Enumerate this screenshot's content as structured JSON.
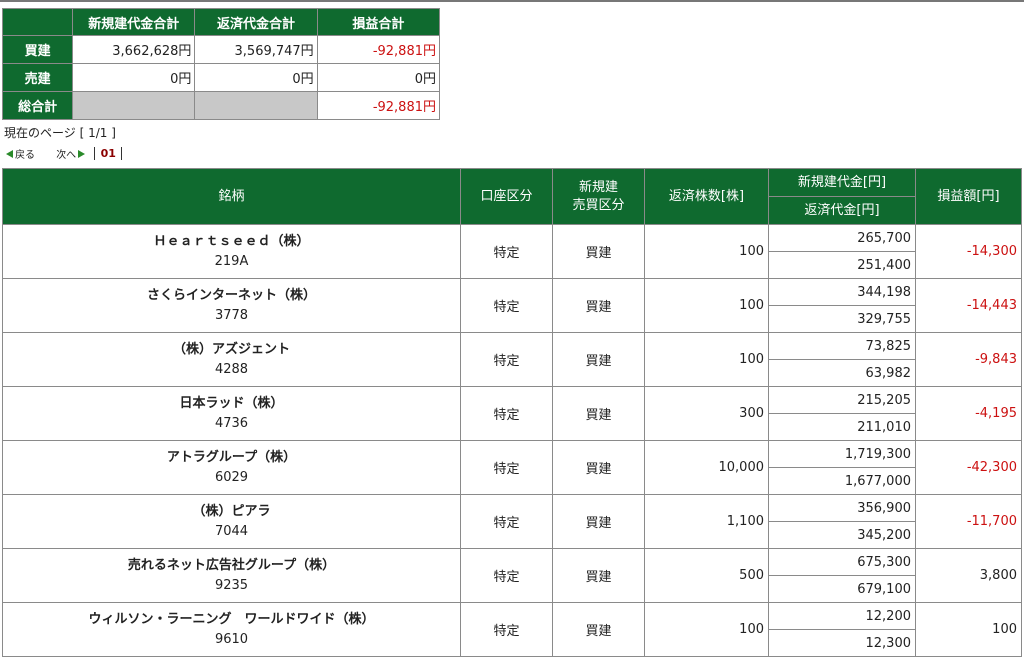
{
  "summary": {
    "headers": [
      "",
      "新規建代金合計",
      "返済代金合計",
      "損益合計"
    ],
    "rows": [
      {
        "label": "買建",
        "new_total": "3,662,628円",
        "return_total": "3,569,747円",
        "pl_total": "-92,881円"
      },
      {
        "label": "売建",
        "new_total": "0円",
        "return_total": "0円",
        "pl_total": "0円"
      },
      {
        "label": "総合計",
        "new_total": "",
        "return_total": "",
        "pl_total": "-92,881円"
      }
    ]
  },
  "pager": {
    "page_info": "現在のページ [ 1/1 ]",
    "back_label": "戻る",
    "next_label": "次へ",
    "current_page": "01"
  },
  "positions": {
    "headers": {
      "name": "銘柄",
      "account": "口座区分",
      "trade_type": "新規建\n売買区分",
      "shares": "返済株数[株]",
      "new_amount": "新規建代金[円]",
      "return_amount": "返済代金[円]",
      "pl": "損益額[円]"
    },
    "rows": [
      {
        "name": "Ｈｅａｒｔｓｅｅｄ（株）",
        "code": "219A",
        "account": "特定",
        "trade_type": "買建",
        "shares": "100",
        "new_amount": "265,700",
        "return_amount": "251,400",
        "pl": "-14,300"
      },
      {
        "name": "さくらインターネット（株）",
        "code": "3778",
        "account": "特定",
        "trade_type": "買建",
        "shares": "100",
        "new_amount": "344,198",
        "return_amount": "329,755",
        "pl": "-14,443"
      },
      {
        "name": "（株）アズジェント",
        "code": "4288",
        "account": "特定",
        "trade_type": "買建",
        "shares": "100",
        "new_amount": "73,825",
        "return_amount": "63,982",
        "pl": "-9,843"
      },
      {
        "name": "日本ラッド（株）",
        "code": "4736",
        "account": "特定",
        "trade_type": "買建",
        "shares": "300",
        "new_amount": "215,205",
        "return_amount": "211,010",
        "pl": "-4,195"
      },
      {
        "name": "アトラグループ（株）",
        "code": "6029",
        "account": "特定",
        "trade_type": "買建",
        "shares": "10,000",
        "new_amount": "1,719,300",
        "return_amount": "1,677,000",
        "pl": "-42,300"
      },
      {
        "name": "（株）ピアラ",
        "code": "7044",
        "account": "特定",
        "trade_type": "買建",
        "shares": "1,100",
        "new_amount": "356,900",
        "return_amount": "345,200",
        "pl": "-11,700"
      },
      {
        "name": "売れるネット広告社グループ（株）",
        "code": "9235",
        "account": "特定",
        "trade_type": "買建",
        "shares": "500",
        "new_amount": "675,300",
        "return_amount": "679,100",
        "pl": "3,800"
      },
      {
        "name": "ウィルソン・ラーニング　ワールドワイド（株）",
        "code": "9610",
        "account": "特定",
        "trade_type": "買建",
        "shares": "100",
        "new_amount": "12,200",
        "return_amount": "12,300",
        "pl": "100"
      }
    ]
  },
  "colors": {
    "header_green": "#0f6a2f",
    "negative": "#cc1111"
  }
}
